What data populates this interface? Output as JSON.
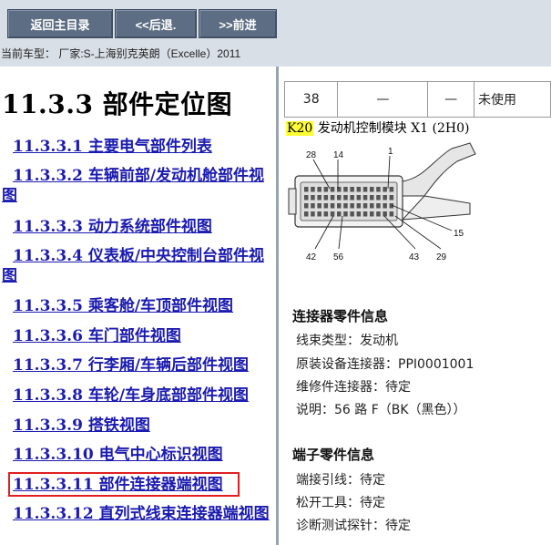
{
  "toolbar": {
    "home_label": "返回主目录",
    "back_label": "<<后退.",
    "forward_label": ">>前进"
  },
  "vehicle": {
    "text": "当前车型： 厂家:S-上海别克英朗（Excelle）2011"
  },
  "left": {
    "title": "11.3.3 部件定位图",
    "links": [
      "11.3.3.1 主要电气部件列表",
      "11.3.3.2 车辆前部/发动机舱部件视图",
      "11.3.3.3 动力系统部件视图",
      "11.3.3.4 仪表板/中央控制台部件视图",
      "11.3.3.5 乘客舱/车顶部件视图",
      "11.3.3.6 车门部件视图",
      "11.3.3.7 行李厢/车辆后部件视图",
      "11.3.3.8 车轮/车身底部部件视图",
      "11.3.3.9 搭铁视图",
      "11.3.3.10 电气中心标识视图",
      "11.3.3.11 部件连接器端视图",
      "11.3.3.12 直列式线束连接器端视图"
    ],
    "highlighted_index": 10,
    "highlight_color": "#e02020"
  },
  "right": {
    "table_row": [
      "38",
      "—",
      "—",
      "未使用"
    ],
    "connector_code": "K20",
    "connector_desc": "发动机控制模块 X1 (2H0)",
    "pin_labels": [
      "28",
      "14",
      "1",
      "15",
      "42",
      "56",
      "43",
      "29"
    ],
    "connector_info_title": "连接器零件信息",
    "connector_info": [
      "线束类型：发动机",
      "原装设备连接器：PPI0001001",
      "维修件连接器：待定",
      "说明：56 路 F（BK（黑色））"
    ],
    "terminal_info_title": "端子零件信息",
    "terminal_info": [
      "端接引线：待定",
      "松开工具：待定",
      "诊断测试探针：待定"
    ]
  },
  "colors": {
    "toolbar_bg": "#d9dfe6",
    "button_bg": "#5d6d83",
    "link": "#1b1bb0",
    "code_highlight": "#ffff33"
  }
}
